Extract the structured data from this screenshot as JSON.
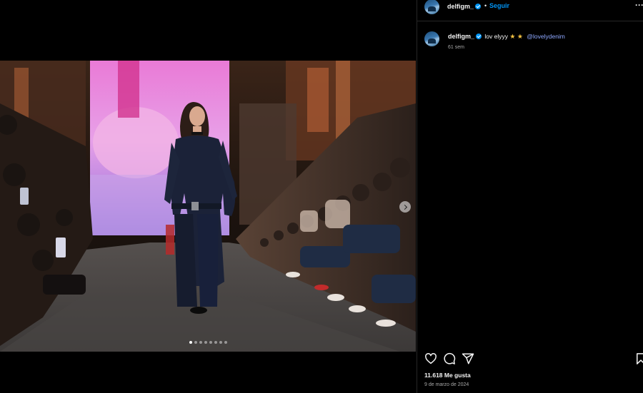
{
  "post": {
    "username": "delfigm_",
    "separator": "•",
    "follow_label": "Seguir",
    "more_label": "···",
    "caption_text": "lov elyyy",
    "caption_stars": "★ ★",
    "caption_mention": "@lovelydenim",
    "time_ago": "61 sem",
    "likes": "11.618 Me gusta",
    "date": "9 de marzo de 2024",
    "accent_color": "#0095f6"
  },
  "carousel": {
    "slide_count": 8,
    "active_index": 0
  },
  "icons": {
    "like": "heart-icon",
    "comment": "comment-icon",
    "share": "share-icon",
    "save": "bookmark-icon",
    "next": "chevron-right-icon",
    "verified": "verified-badge-icon",
    "more": "more-options-icon"
  }
}
